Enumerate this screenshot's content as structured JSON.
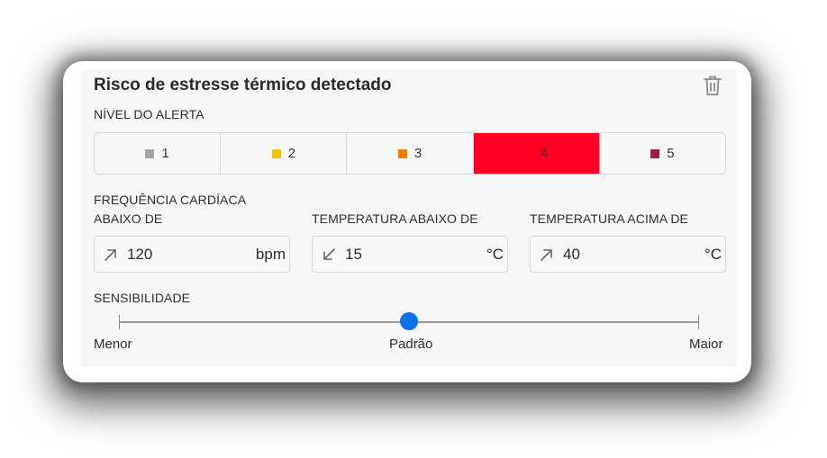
{
  "card": {
    "title": "Risco de estresse térmico detectado"
  },
  "alert_level": {
    "label": "NÍVEL DO ALERTA",
    "selected": "4",
    "options": [
      {
        "label": "1",
        "color": "#a3a3a3"
      },
      {
        "label": "2",
        "color": "#f5c000"
      },
      {
        "label": "3",
        "color": "#f57c00"
      },
      {
        "label": "4",
        "color": "#ff0022"
      },
      {
        "label": "5",
        "color": "#a0194a"
      }
    ]
  },
  "fields": {
    "heart_rate": {
      "label_line1": "FREQUÊNCIA CARDÍACA",
      "label_line2": "ABAIXO DE",
      "value": "120",
      "unit": "bpm",
      "icon": "arrow-up-right-icon"
    },
    "temp_below": {
      "label": "TEMPERATURA ABAIXO DE",
      "value": "15",
      "unit": "°C",
      "icon": "arrow-down-left-icon"
    },
    "temp_above": {
      "label": "TEMPERATURA ACIMA DE",
      "value": "40",
      "unit": "°C",
      "icon": "arrow-up-right-icon"
    }
  },
  "sensitivity": {
    "label": "SENSIBILIDADE",
    "min_label": "Menor",
    "mid_label": "Padrão",
    "max_label": "Maior",
    "value_fraction": 0.5
  },
  "accent_color": "#0a6ff0"
}
